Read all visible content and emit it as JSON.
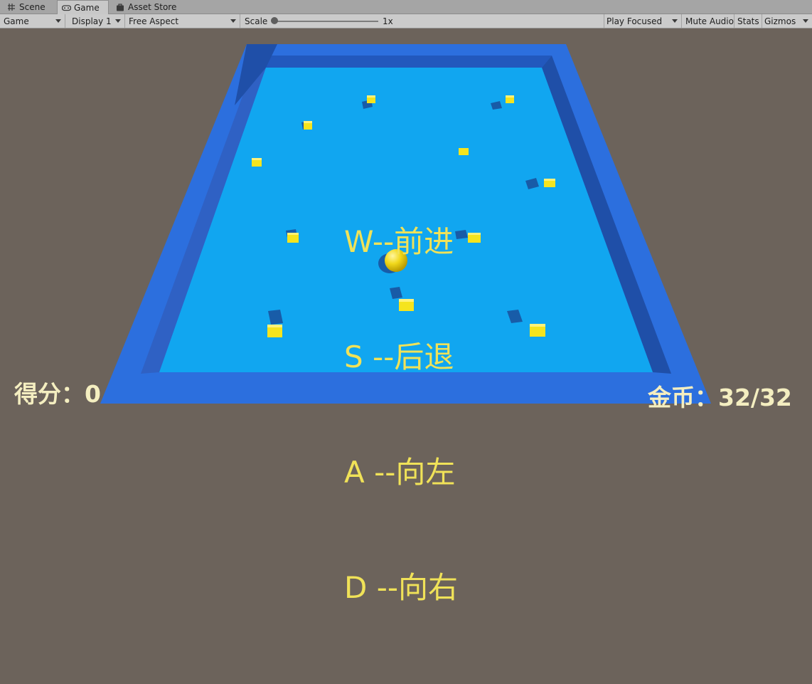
{
  "tabs": [
    {
      "label": "Scene",
      "icon": "grid-icon",
      "active": false
    },
    {
      "label": "Game",
      "icon": "gamepad-icon",
      "active": true
    },
    {
      "label": "Asset Store",
      "icon": "bag-icon",
      "active": false
    }
  ],
  "toolbar": {
    "view_mode": "Game",
    "display": "Display 1",
    "aspect": "Free Aspect",
    "scale_label": "Scale",
    "scale_value": "1x",
    "scale_fraction": 0.0,
    "play_mode": "Play Focused",
    "mute_audio": "Mute Audio",
    "stats": "Stats",
    "gizmos": "Gizmos"
  },
  "instructions": [
    "W--前进",
    "S --后退",
    "A --向左",
    "D --向右"
  ],
  "hud": {
    "score_label": "得分：",
    "score_value": "0",
    "coins_label": "金币：",
    "coins_value": "32/32"
  },
  "colors": {
    "board_wall": "#2c6fde",
    "board_floor": "#11a6f0",
    "coin": "#f5e41e",
    "text_yellow": "#f0e258",
    "background": "#6c635b"
  }
}
